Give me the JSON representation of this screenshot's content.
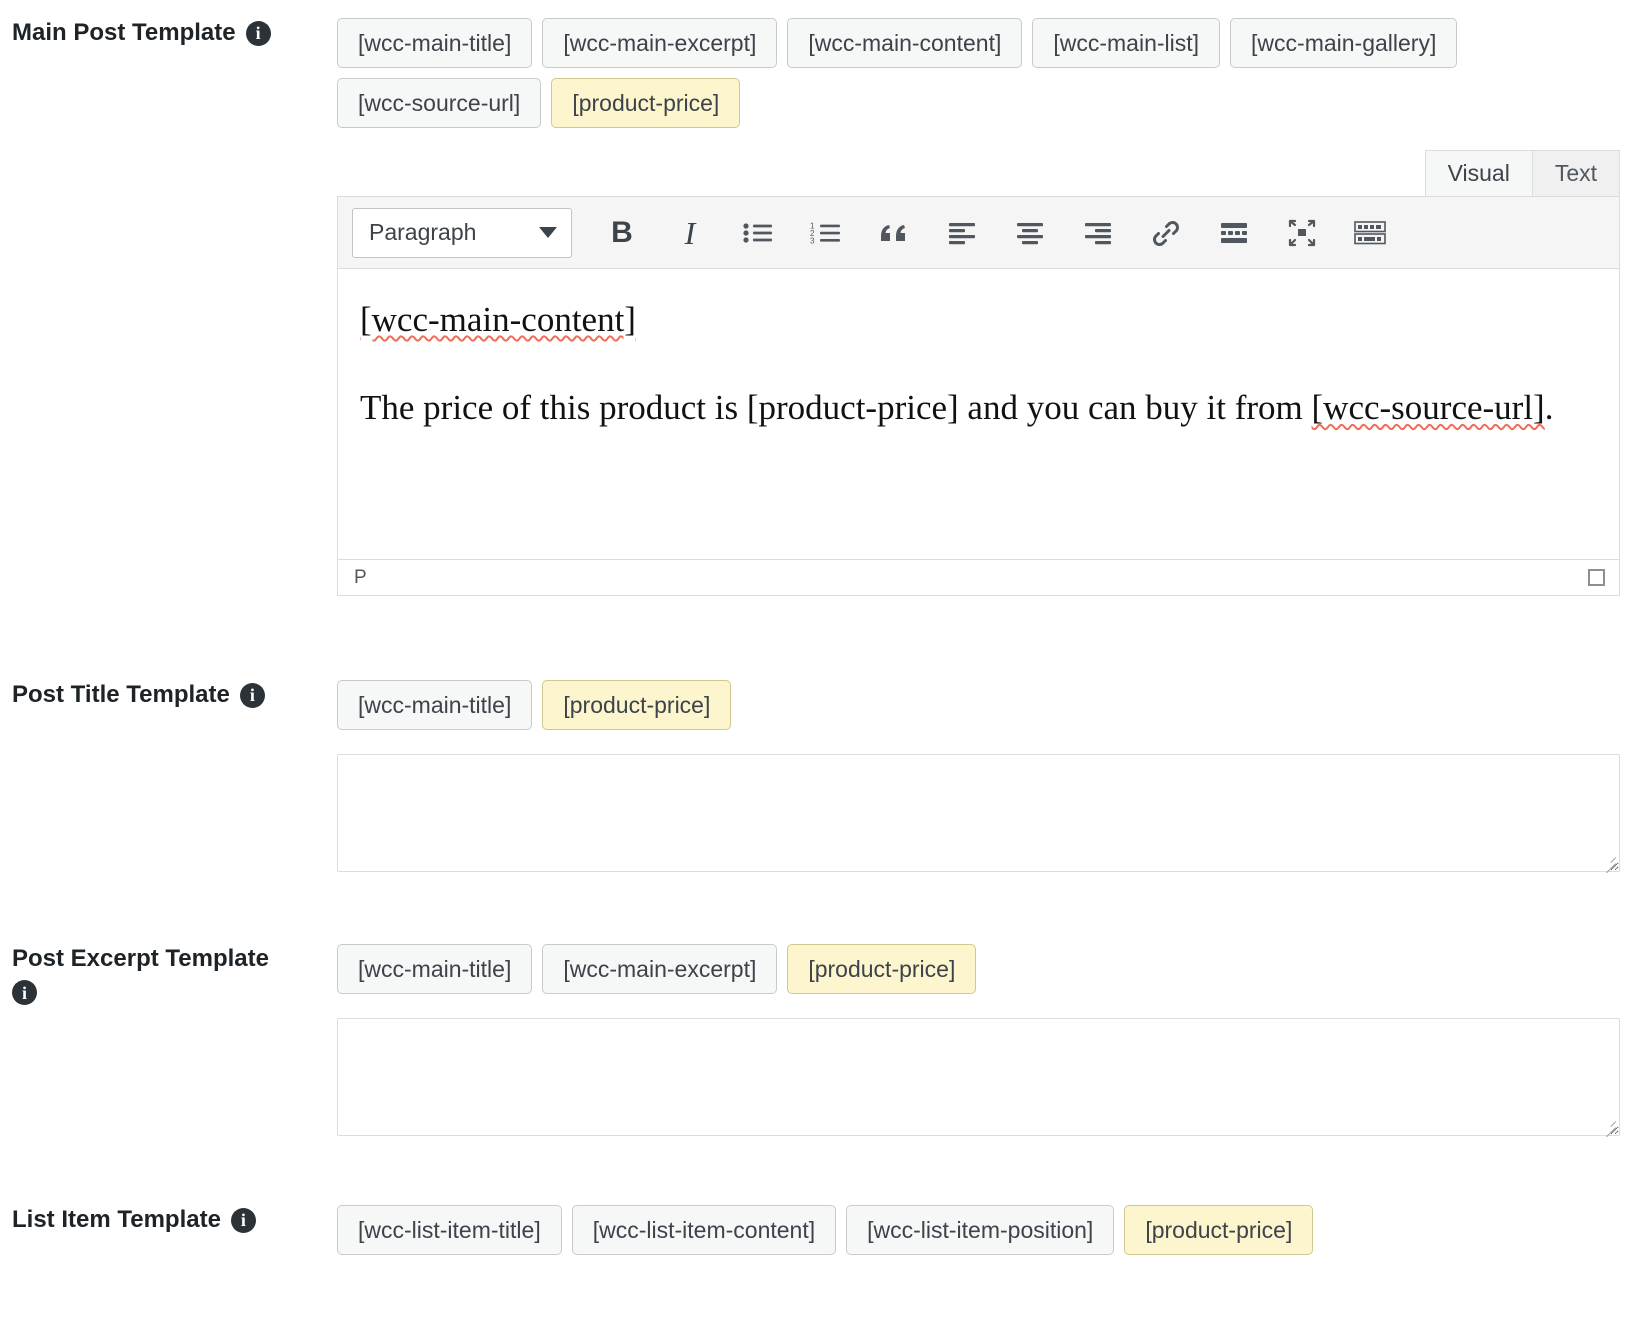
{
  "sections": {
    "main_post": {
      "label": "Main Post Template",
      "info_icon": "info-icon",
      "chips": [
        {
          "text": "[wcc-main-title]",
          "highlight": false
        },
        {
          "text": "[wcc-main-excerpt]",
          "highlight": false
        },
        {
          "text": "[wcc-main-content]",
          "highlight": false
        },
        {
          "text": "[wcc-main-list]",
          "highlight": false
        },
        {
          "text": "[wcc-main-gallery]",
          "highlight": false
        },
        {
          "text": "[wcc-source-url]",
          "highlight": false
        },
        {
          "text": "[product-price]",
          "highlight": true
        }
      ],
      "editor": {
        "tabs": [
          {
            "label": "Visual",
            "active": true
          },
          {
            "label": "Text",
            "active": false
          }
        ],
        "format_select": "Paragraph",
        "toolbar_buttons": [
          "bold-icon",
          "italic-icon",
          "bulleted-list-icon",
          "numbered-list-icon",
          "blockquote-icon",
          "align-left-icon",
          "align-center-icon",
          "align-right-icon",
          "link-icon",
          "read-more-icon",
          "fullscreen-icon",
          "toolbar-toggle-icon"
        ],
        "content_paragraph_1": "[wcc-main-content]",
        "content_paragraph_2_a": "The price of this product is [product-price] and you can buy it from ",
        "content_paragraph_2_b": "[wcc-source-url]",
        "content_paragraph_2_c": ".",
        "status_path": "P"
      }
    },
    "post_title": {
      "label": "Post Title Template",
      "info_icon": "info-icon",
      "chips": [
        {
          "text": "[wcc-main-title]",
          "highlight": false
        },
        {
          "text": "[product-price]",
          "highlight": true
        }
      ],
      "textarea_value": "",
      "textarea_placeholder": ""
    },
    "post_excerpt": {
      "label": "Post Excerpt Template",
      "info_icon": "info-icon",
      "chips": [
        {
          "text": "[wcc-main-title]",
          "highlight": false
        },
        {
          "text": "[wcc-main-excerpt]",
          "highlight": false
        },
        {
          "text": "[product-price]",
          "highlight": true
        }
      ],
      "textarea_value": "",
      "textarea_placeholder": ""
    },
    "list_item": {
      "label": "List Item Template",
      "info_icon": "info-icon",
      "chips": [
        {
          "text": "[wcc-list-item-title]",
          "highlight": false
        },
        {
          "text": "[wcc-list-item-content]",
          "highlight": false
        },
        {
          "text": "[wcc-list-item-position]",
          "highlight": false
        },
        {
          "text": "[product-price]",
          "highlight": true
        }
      ]
    }
  },
  "colors": {
    "chip_bg": "#f6f7f7",
    "chip_border": "#c8cbce",
    "chip_highlight_bg": "#fdf5cd",
    "chip_highlight_border": "#cfc98f",
    "text": "#3c434a",
    "label": "#1d2327",
    "spellcheck_underline": "#f26c5a",
    "toolbar_bg": "#f5f5f5",
    "border": "#dcdcde"
  },
  "info_glyph": "i"
}
